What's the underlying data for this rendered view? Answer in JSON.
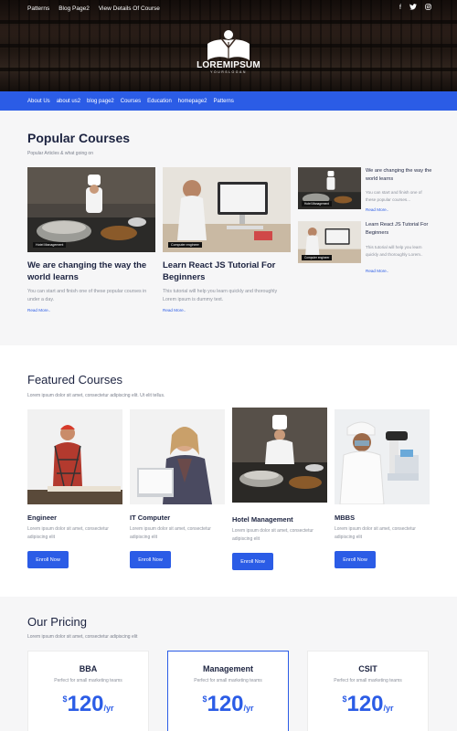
{
  "topbar": {
    "links": [
      "Patterns",
      "Blog Page2",
      "View Details Of Course"
    ],
    "social_icons": [
      "facebook-icon",
      "twitter-icon",
      "instagram-icon"
    ]
  },
  "logo": {
    "name": "LOREMIPSUM",
    "tagline": "YOURSLOGAN"
  },
  "nav": {
    "items": [
      "About Us",
      "about us2",
      "blog page2",
      "Courses",
      "Education",
      "homepage2",
      "Patterns"
    ]
  },
  "popular": {
    "title": "Popular Courses",
    "subtitle": "Popular Articles & what going on",
    "cards": [
      {
        "badge": "Hotel Management",
        "title": "We are changing the way the world learns",
        "text": "You can start and finish one of these popular courses in under a day.",
        "read": "Read More.."
      },
      {
        "badge": "Computer engineer",
        "title": "Learn React JS Tutorial For Beginners",
        "text": "This tutorial will help you learn quickly and thoroughly Lorem ipsum is dummy text.",
        "read": "Read More.."
      }
    ],
    "side_cards": [
      {
        "badge": "Hotel Management",
        "title": "We are changing the way the world learns",
        "text": "You can start and finish one of these popular courses...",
        "read": "Read More.."
      },
      {
        "badge": "Computer engineer",
        "title": "Learn React JS Tutorial For Beginners",
        "text": "This tutorial will help you learn quickly and thoroughly Lorem..",
        "read": "Read More.."
      }
    ]
  },
  "featured": {
    "title": "Featured Courses",
    "subtitle": "Lorem ipsum dolor sit amet, consectetur adipiscing elit. Ut elit tellus.",
    "courses": [
      {
        "name": "Engineer",
        "text": "Lorem ipsum dolor sit amet, consectetur adipiscing elit",
        "button": "Enroll Now"
      },
      {
        "name": "IT Computer",
        "text": "Lorem ipsum dolor sit amet, consectetur adipiscing elit",
        "button": "Enroll Now"
      },
      {
        "name": "Hotel Management",
        "text": "Lorem ipsum dolor sit amet, consectetur adipiscing elit",
        "button": "Enroll Now"
      },
      {
        "name": "MBBS",
        "text": "Lorem ipsum dolor sit amet, consectetur adipiscing elit",
        "button": "Enroll Now"
      }
    ]
  },
  "pricing": {
    "title": "Our Pricing",
    "subtitle": "Lorem ipsum dolor sit amet, consectetur adipiscing elit",
    "plans": [
      {
        "name": "BBA",
        "sub": "Perfect for small marketing teams",
        "currency": "$",
        "amount": "120",
        "period": "/yr"
      },
      {
        "name": "Management",
        "sub": "Perfect for small marketing teams",
        "currency": "$",
        "amount": "120",
        "period": "/yr"
      },
      {
        "name": "CSIT",
        "sub": "Perfect for small marketing teams",
        "currency": "$",
        "amount": "120",
        "period": "/yr"
      }
    ]
  },
  "colors": {
    "accent": "#2b5ce6",
    "heading": "#1c2340",
    "muted": "#8b909b"
  }
}
